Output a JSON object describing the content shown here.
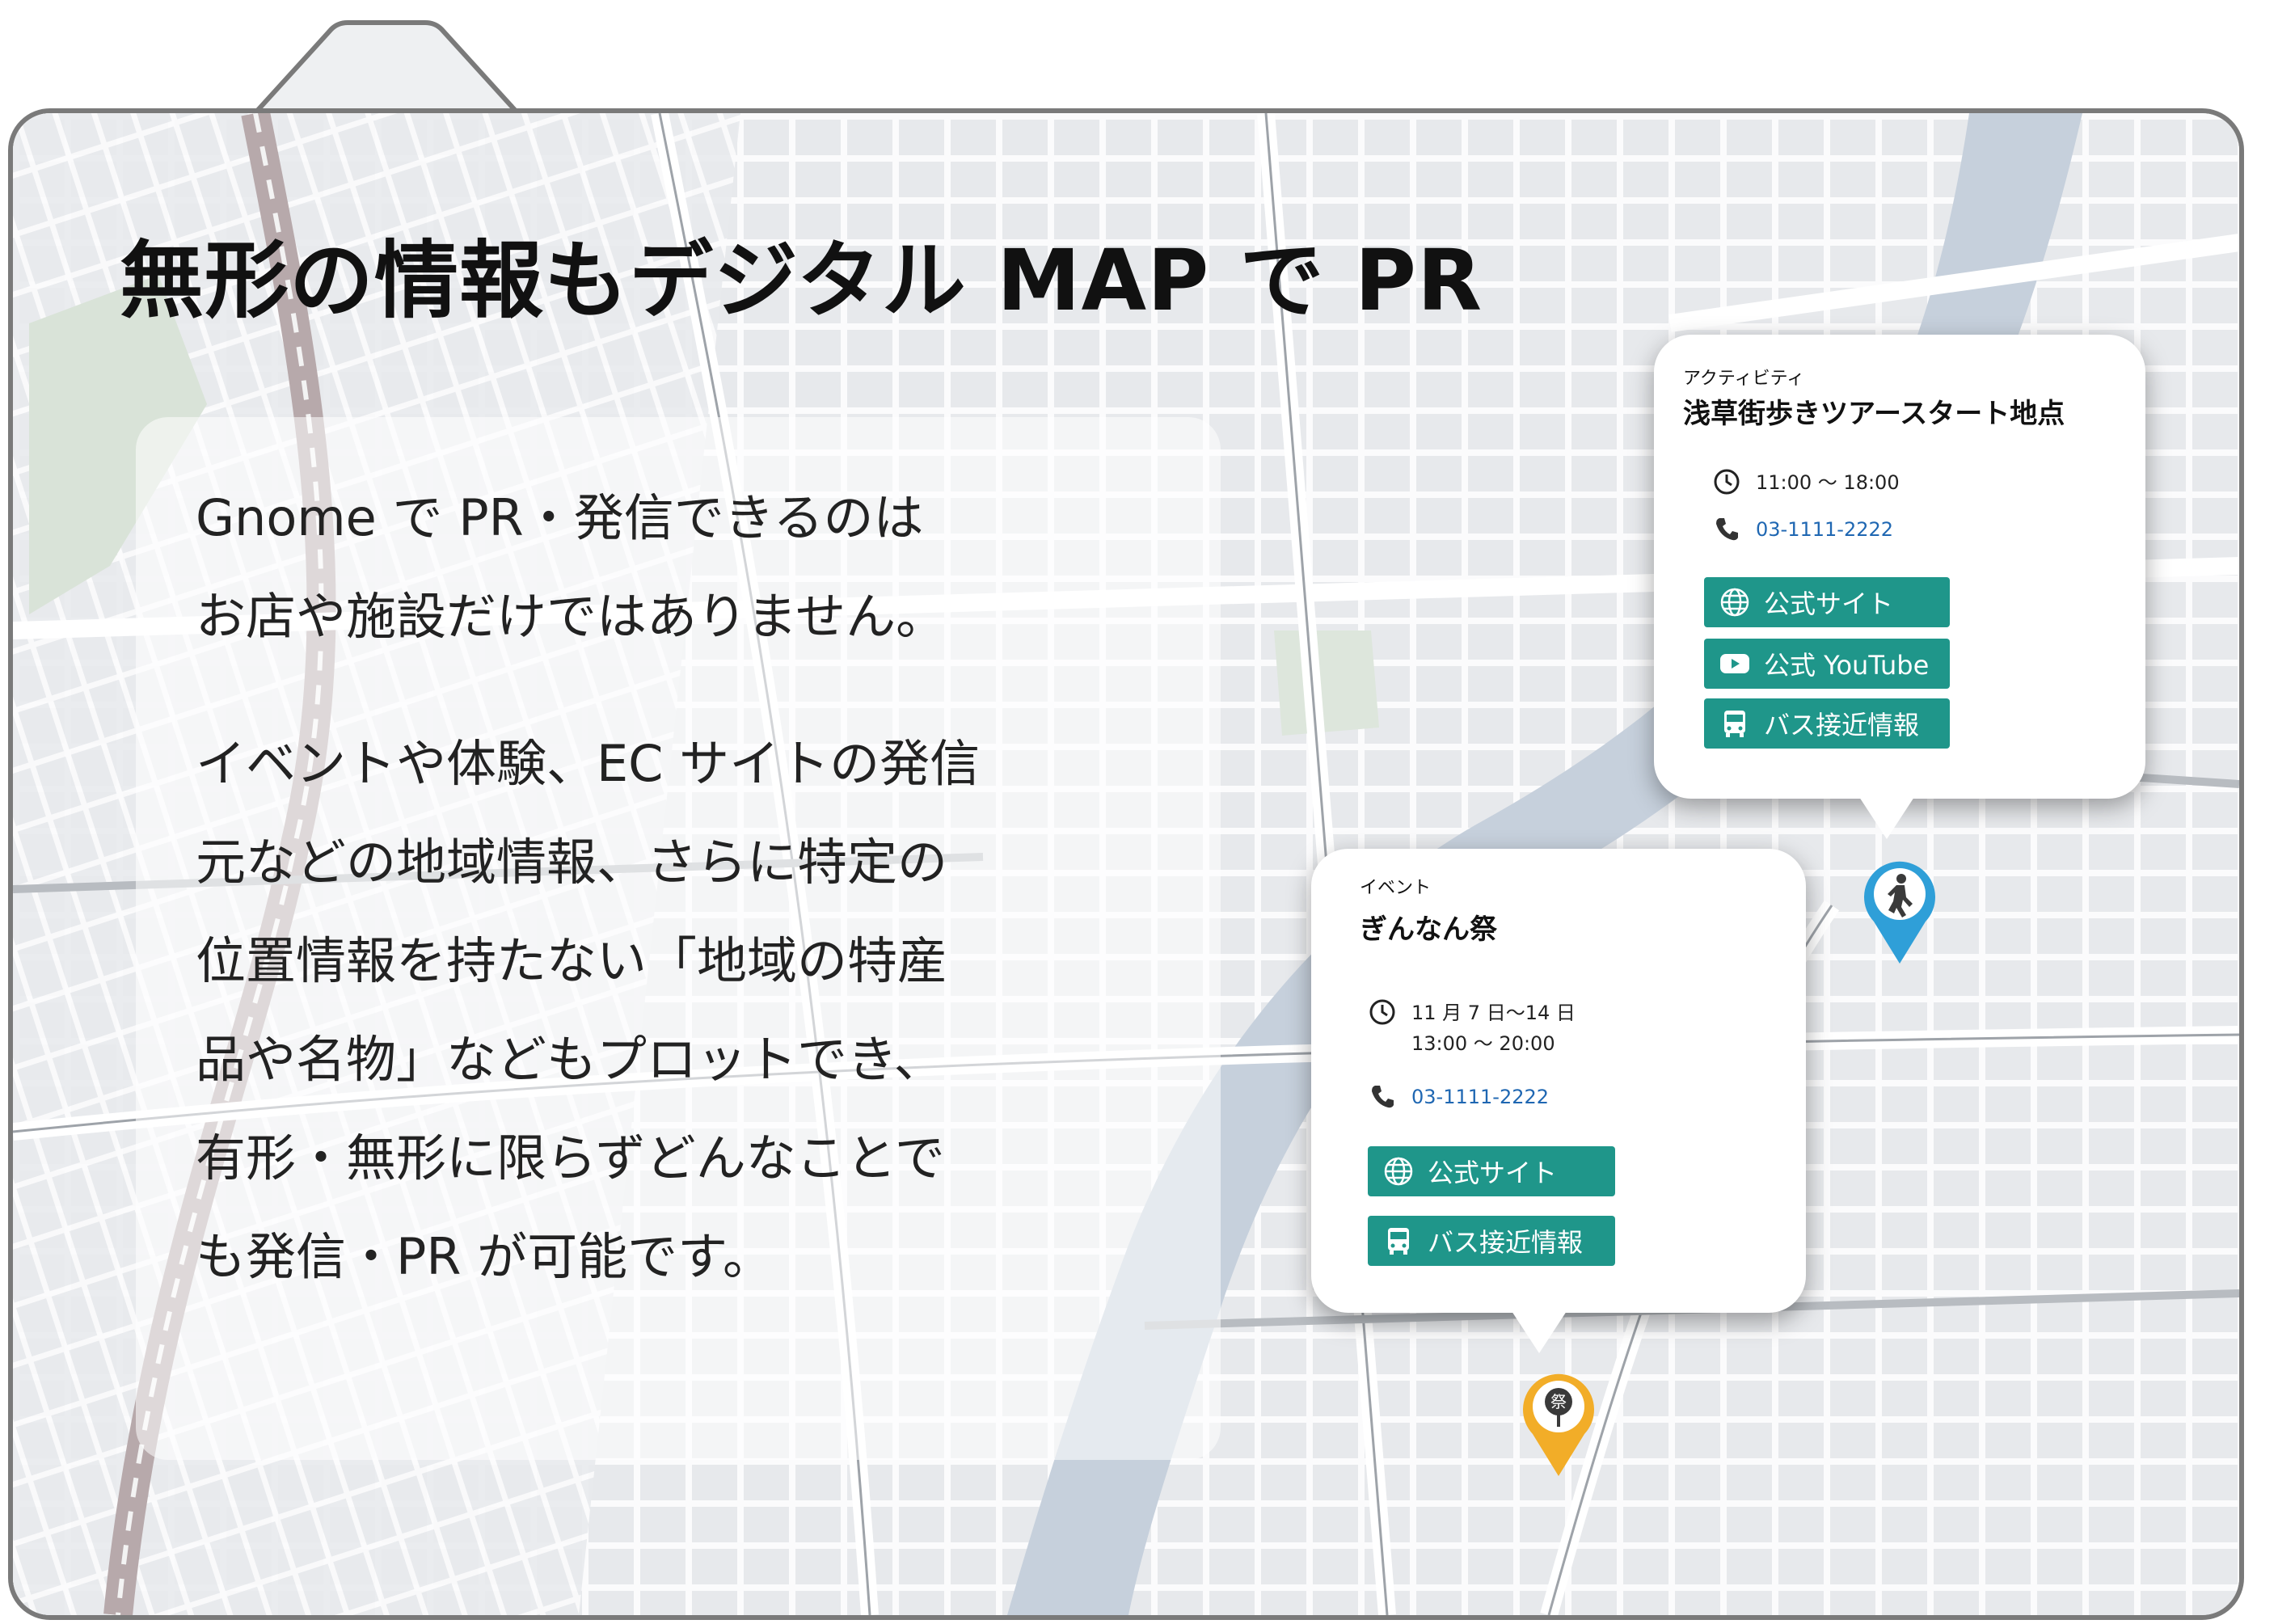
{
  "title": "無形の情報もデジタル MAP で PR",
  "body": {
    "paragraph1": [
      "Gnome で PR・発信できるのは",
      "お店や施設だけではありません。"
    ],
    "paragraph2": [
      "イベントや体験、EC サイトの発信",
      "元などの地域情報、さらに特定の",
      "位置情報を持たない「地域の特産",
      "品や名物」などもプロットでき、",
      "有形・無形に限らずどんなことで",
      "も発信・PR が可能です。"
    ]
  },
  "card_activity": {
    "category": "アクティビティ",
    "name": "浅草街歩きツアースタート地点",
    "hours": "11:00 〜 18:00",
    "phone": "03-1111-2222",
    "buttons": [
      "公式サイト",
      "公式 YouTube",
      "バス接近情報"
    ]
  },
  "card_event": {
    "category": "イベント",
    "name": "ぎんなん祭",
    "dates": "11 月 7 日〜14 日",
    "hours": "13:00 〜 20:00",
    "phone": "03-1111-2222",
    "buttons": [
      "公式サイト",
      "バス接近情報"
    ]
  },
  "pins": {
    "event_label": "祭"
  },
  "colors": {
    "button": "#1f968a",
    "phone_link": "#1f67b2",
    "pin_activity": "#2f9fd8",
    "pin_event": "#f2ad28",
    "frame_border": "#7a7a7a"
  }
}
